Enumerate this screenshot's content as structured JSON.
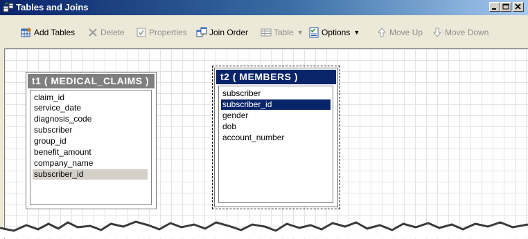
{
  "window": {
    "title": "Tables and Joins",
    "icon": "tables-joins-icon",
    "buttons": [
      "minimize-icon",
      "maximize-icon",
      "close-icon"
    ]
  },
  "toolbar": {
    "items": [
      {
        "label": "Add Tables",
        "icon": "add-tables-icon",
        "enabled": true
      },
      {
        "label": "Delete",
        "icon": "delete-x-icon",
        "enabled": false
      },
      {
        "label": "Properties",
        "icon": "properties-icon",
        "enabled": false
      },
      {
        "label": "Join Order",
        "icon": "join-order-icon",
        "enabled": true
      },
      {
        "label": "Table",
        "icon": "table-icon",
        "enabled": false,
        "dropdown": true
      },
      {
        "label": "Options",
        "icon": "options-icon",
        "enabled": true,
        "dropdown": true
      },
      {
        "label": "Move Up",
        "icon": "arrow-up-icon",
        "enabled": false
      },
      {
        "label": "Move Down",
        "icon": "arrow-down-icon",
        "enabled": false
      }
    ]
  },
  "tables": [
    {
      "title": "t1 ( MEDICAL_CLAIMS )",
      "active": false,
      "fields": [
        "claim_id",
        "service_date",
        "diagnosis_code",
        "subscriber",
        "group_id",
        "benefit_amount",
        "company_name",
        "subscriber_id"
      ],
      "highlighted_field": "subscriber_id"
    },
    {
      "title": "t2 ( MEMBERS )",
      "active": true,
      "fields": [
        "subscriber",
        "subscriber_id",
        "gender",
        "dob",
        "account_number"
      ],
      "selected_field": "subscriber_id"
    }
  ],
  "colors": {
    "title_gradient_start": "#0a246a",
    "title_gradient_end": "#a6caf0",
    "active_header": "#0a246a",
    "inactive_header": "#7f7f7f",
    "window_bg": "#ece9d8"
  }
}
